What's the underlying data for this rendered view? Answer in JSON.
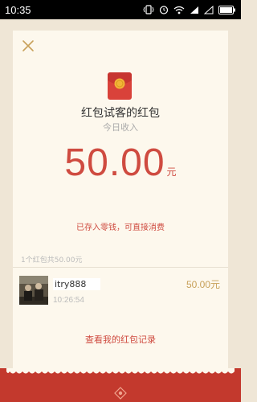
{
  "status_bar": {
    "time": "10:35"
  },
  "icons": {
    "close": "close-icon",
    "packet": "red-packet-icon",
    "badge": "red-packet-seal-icon",
    "vibrate": "vibrate-icon",
    "alarm": "alarm-icon",
    "wifi": "wifi-icon",
    "signal": "signal-icon",
    "battery": "battery-icon"
  },
  "packet": {
    "sender": "红包试客的红包",
    "subtitle": "今日收入",
    "amount": "50.00",
    "unit": "元",
    "saved_note": "已存入零钱，可直接消费"
  },
  "records": {
    "summary": "1个红包共50.00元",
    "items": [
      {
        "name": "itry888",
        "time": "10:26:54",
        "amount": "50.00元"
      }
    ]
  },
  "history_link": "查看我的红包记录",
  "colors": {
    "accent_red": "#cf4b40",
    "gold": "#c8a15a",
    "card_bg": "#fdf8ed",
    "page_bg": "#efe6d6",
    "band_red": "#c3392d"
  }
}
